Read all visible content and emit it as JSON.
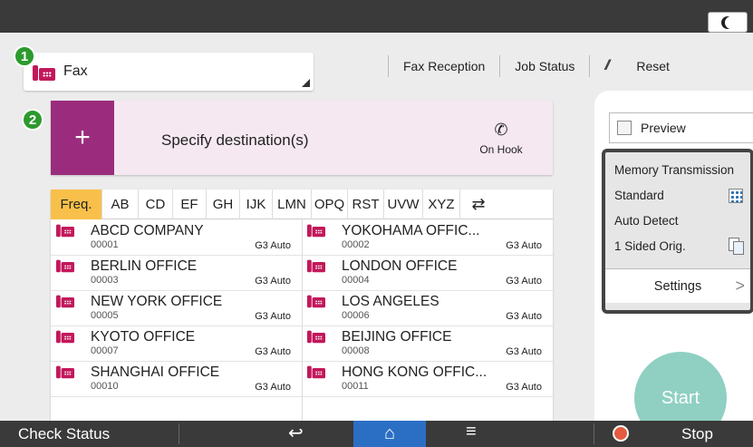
{
  "header": {
    "moon_icon": "moon-icon"
  },
  "fax_selector": {
    "label": "Fax",
    "badge": "1"
  },
  "toolbar": {
    "fax_reception": "Fax Reception",
    "job_status": "Job Status",
    "reset_icon": "reset-icon",
    "reset": "Reset"
  },
  "destination": {
    "badge": "2",
    "plus": "+",
    "label": "Specify destination(s)",
    "on_hook": "On Hook"
  },
  "address_book": {
    "tabs": [
      "Freq.",
      "AB",
      "CD",
      "EF",
      "GH",
      "IJK",
      "LMN",
      "OPQ",
      "RST",
      "UVW",
      "XYZ"
    ],
    "active_tab": "Freq.",
    "entries": [
      {
        "name": "ABCD COMPANY",
        "number": "00001",
        "mode": "G3 Auto"
      },
      {
        "name": "YOKOHAMA OFFIC...",
        "number": "00002",
        "mode": "G3 Auto"
      },
      {
        "name": "BERLIN OFFICE",
        "number": "00003",
        "mode": "G3 Auto"
      },
      {
        "name": "LONDON OFFICE",
        "number": "00004",
        "mode": "G3 Auto"
      },
      {
        "name": "NEW YORK OFFICE",
        "number": "00005",
        "mode": "G3 Auto"
      },
      {
        "name": "LOS ANGELES",
        "number": "00006",
        "mode": "G3 Auto"
      },
      {
        "name": "KYOTO OFFICE",
        "number": "00007",
        "mode": "G3 Auto"
      },
      {
        "name": "BEIJING OFFICE",
        "number": "00008",
        "mode": "G3 Auto"
      },
      {
        "name": "SHANGHAI  OFFICE",
        "number": "00010",
        "mode": "G3 Auto"
      },
      {
        "name": "HONG KONG OFFIC...",
        "number": "00011",
        "mode": "G3 Auto"
      }
    ]
  },
  "settings_panel": {
    "preview": "Preview",
    "memory_transmission": "Memory Transmission",
    "standard": "Standard",
    "auto_detect": "Auto Detect",
    "sided": "1 Sided Orig.",
    "settings": "Settings",
    "chevron": ">"
  },
  "start": {
    "label": "Start"
  },
  "bottom_bar": {
    "check_status": "Check Status",
    "back": "↩",
    "home": "⌂",
    "menu": "≡",
    "stop": "Stop"
  },
  "colors": {
    "accent_purple": "#9b2c7d",
    "fax_pink": "#c2185b",
    "active_tab": "#f8c04a",
    "badge_green": "#2d9a2d",
    "start_teal": "#8fd0c2",
    "home_blue": "#2b6fc4"
  }
}
